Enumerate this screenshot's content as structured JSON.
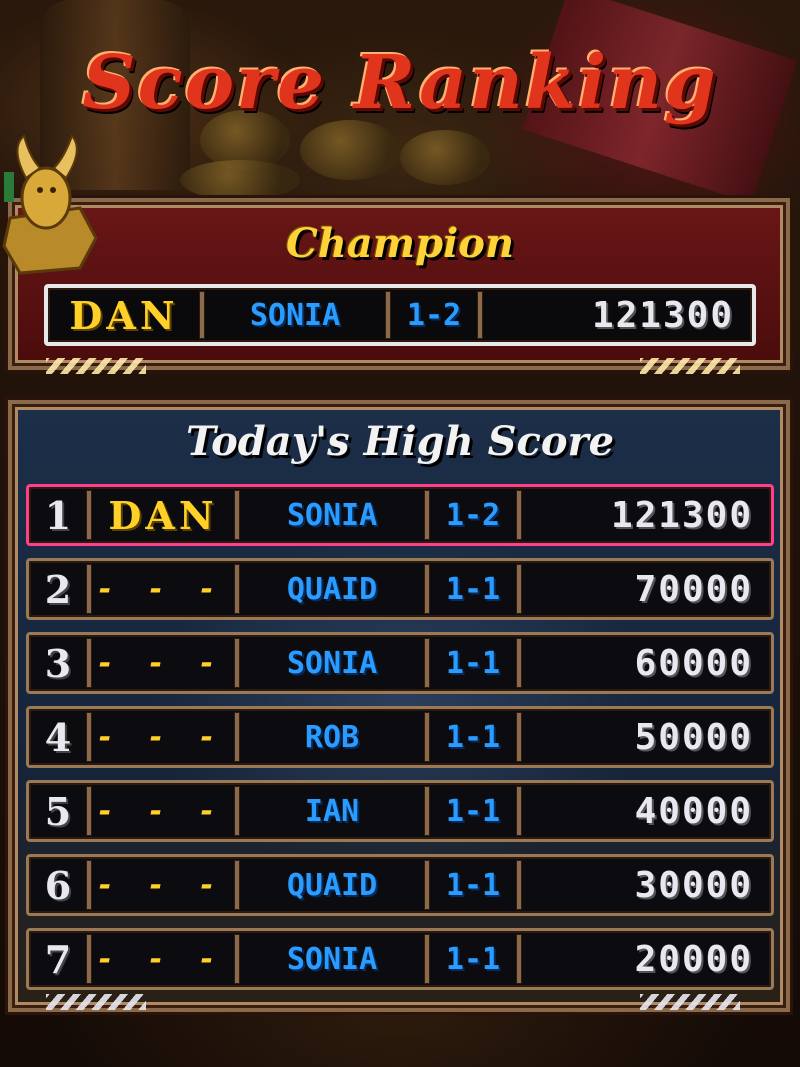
{
  "title": "Score Ranking",
  "champion": {
    "heading": "Champion",
    "name": "DAN",
    "character": "SONIA",
    "stage": "1-2",
    "score": "121300"
  },
  "today": {
    "heading": "Today's High Score",
    "rows": [
      {
        "rank": "1",
        "name": "DAN",
        "character": "SONIA",
        "stage": "1-2",
        "score": "121300",
        "highlighted": true
      },
      {
        "rank": "2",
        "name": "- - -",
        "character": "QUAID",
        "stage": "1-1",
        "score": "70000"
      },
      {
        "rank": "3",
        "name": "- - -",
        "character": "SONIA",
        "stage": "1-1",
        "score": "60000"
      },
      {
        "rank": "4",
        "name": "- - -",
        "character": "ROB",
        "stage": "1-1",
        "score": "50000"
      },
      {
        "rank": "5",
        "name": "- - -",
        "character": "IAN",
        "stage": "1-1",
        "score": "40000"
      },
      {
        "rank": "6",
        "name": "- - -",
        "character": "QUAID",
        "stage": "1-1",
        "score": "30000"
      },
      {
        "rank": "7",
        "name": "- - -",
        "character": "SONIA",
        "stage": "1-1",
        "score": "20000"
      }
    ]
  },
  "colors": {
    "title_red": "#e0341c",
    "champion_gold": "#ffd23a",
    "character_blue": "#2a9cff",
    "highlight_pink": "#ff3f8a"
  },
  "icons": [
    "gargoyle-statue-icon"
  ]
}
